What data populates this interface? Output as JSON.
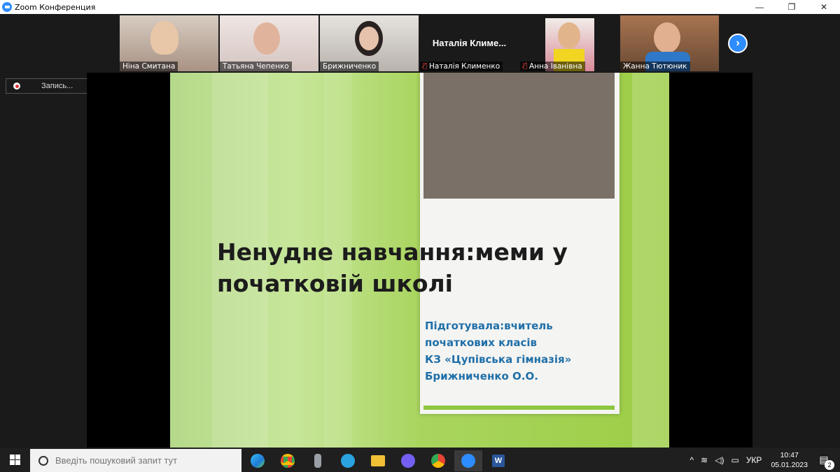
{
  "window": {
    "title": "Zoom Конференция",
    "minimize": "—",
    "restore": "❐",
    "close": "✕"
  },
  "participants": [
    {
      "name": "Ніна Смитана",
      "muted": false,
      "active": true,
      "bg": "#b9a89c"
    },
    {
      "name": "Татьяна Чепенко",
      "muted": false,
      "active": false,
      "bg": "#d9c8c2"
    },
    {
      "name": "Брижниченко",
      "muted": false,
      "active": false,
      "bg": "#c9c5c0"
    },
    {
      "name": "Наталія Клименко",
      "muted": true,
      "active": false,
      "display": "Наталія Климе...",
      "bg": "#1a1a1a"
    },
    {
      "name": "Анна Іванівна",
      "muted": true,
      "active": false,
      "bg": "#d8b27a"
    },
    {
      "name": "Жанна Тютюник",
      "muted": false,
      "active": false,
      "bg": "#9a6e4c"
    }
  ],
  "record": {
    "label": "Запись..."
  },
  "slide": {
    "heading_line1": "Ненудне навчання:меми у",
    "heading_line2": "початковій школі",
    "author_lines": [
      "Підготувала:вчитель",
      "початкових класів",
      "КЗ «Цупівська гімназія»",
      "Брижниченко О.О."
    ]
  },
  "taskbar": {
    "search_placeholder": "Введіть пошуковий запит тут",
    "apps": [
      "edge-icon",
      "chrome-icon",
      "recorder-icon",
      "telegram-icon",
      "file-explorer-icon",
      "viber-icon",
      "chrome-profile-icon",
      "zoom-icon",
      "word-icon"
    ],
    "app_colors": [
      "#2a9fd8",
      "#e8453c",
      "#9aa0a6",
      "#2aa3e0",
      "#f2c037",
      "#7360f2",
      "#e8453c",
      "#2d8cff",
      "#2b579a"
    ],
    "language": "УКР",
    "time": "10:47",
    "date": "05.01.2023",
    "notifications": "2"
  }
}
